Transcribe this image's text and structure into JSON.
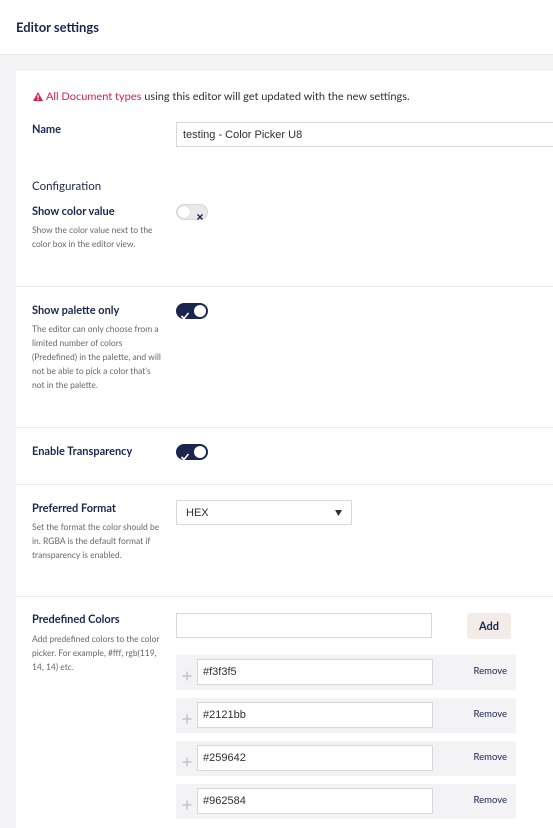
{
  "header": {
    "title": "Editor settings"
  },
  "notice": {
    "highlight": "All Document types",
    "text": " using this editor will get updated with the new settings."
  },
  "name_field": {
    "label": "Name",
    "value": "testing - Color Picker U8"
  },
  "configuration": {
    "title": "Configuration",
    "show_color_value": {
      "label": "Show color value",
      "description": "Show the color value next to the color box in the editor view.",
      "enabled": false
    },
    "show_palette_only": {
      "label": "Show palette only",
      "description": "The editor can only choose from a limited number of colors (Predefined) in the palette, and will not be able to pick a color that's not in the palette.",
      "enabled": true
    },
    "enable_transparency": {
      "label": "Enable Transparency",
      "enabled": true
    },
    "preferred_format": {
      "label": "Preferred Format",
      "description": "Set the format the color should be in. RGBA is the default format if transparency is enabled.",
      "selected": "HEX"
    },
    "predefined_colors": {
      "label": "Predefined Colors",
      "description": "Add predefined colors to the color picker. For example, #fff, rgb(119, 14, 14) etc.",
      "new_value": "",
      "add_label": "Add",
      "remove_label": "Remove",
      "colors": [
        "#f3f3f5",
        "#2121bb",
        "#259642",
        "#962584"
      ]
    }
  },
  "colors": {
    "navy": "#1b264f",
    "danger": "#d42054",
    "toggle_on": "#1b264f",
    "add_button_bg": "#f3ece8"
  }
}
